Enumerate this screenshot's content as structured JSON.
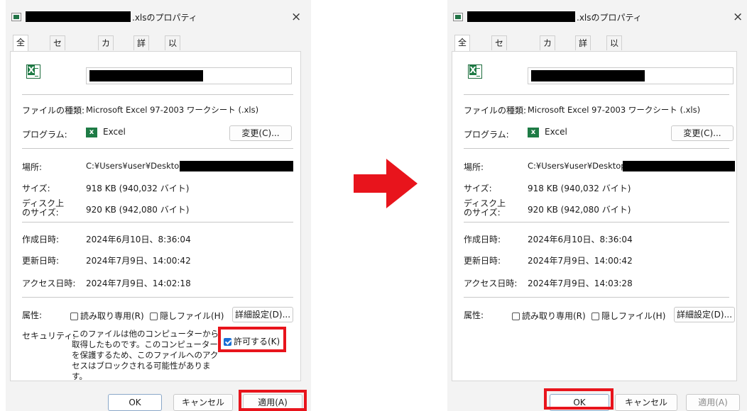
{
  "left": {
    "title_suffix": ".xlsのプロパティ",
    "close": "×",
    "tabs": [
      "全般",
      "セキュリティ",
      "カスタム",
      "詳細",
      "以前のバージョン"
    ],
    "file_type_label": "ファイルの種類:",
    "file_type_value": "Microsoft Excel 97-2003 ワークシート (.xls)",
    "program_label": "プログラム:",
    "program_value": "Excel",
    "change_button": "変更(C)...",
    "location_label": "場所:",
    "location_value": "C:¥Users¥user¥Desktop¥",
    "size_label": "サイズ:",
    "size_value": "918 KB (940,032 バイト)",
    "disk_size_label_1": "ディスク上",
    "disk_size_label_2": "のサイズ:",
    "disk_size_value": "920 KB (942,080 バイト)",
    "created_label": "作成日時:",
    "created_value": "2024年6月10日、8:36:04",
    "modified_label": "更新日時:",
    "modified_value": "2024年7月9日、14:00:42",
    "accessed_label": "アクセス日時:",
    "accessed_value": "2024年7月9日、14:02:18",
    "attr_label": "属性:",
    "readonly_label": "読み取り専用(R)",
    "hidden_label": "隠しファイル(H)",
    "advanced_button": "詳細設定(D)...",
    "security_label": "セキュリティ:",
    "security_text": "このファイルは他のコンピューターから取得したものです。このコンピューターを保護するため、このファイルへのアクセスはブロックされる可能性があります。",
    "unblock_label": "許可する(K)",
    "ok": "OK",
    "cancel": "キャンセル",
    "apply": "適用(A)"
  },
  "right": {
    "title_suffix": ".xlsのプロパティ",
    "close": "×",
    "tabs": [
      "全般",
      "セキュリティ",
      "カスタム",
      "詳細",
      "以前のバージョン"
    ],
    "file_type_label": "ファイルの種類:",
    "file_type_value": "Microsoft Excel 97-2003 ワークシート (.xls)",
    "program_label": "プログラム:",
    "program_value": "Excel",
    "change_button": "変更(C)...",
    "location_label": "場所:",
    "location_value": "C:¥Users¥user¥Desktop¥",
    "size_label": "サイズ:",
    "size_value": "918 KB (940,032 バイト)",
    "disk_size_label_1": "ディスク上",
    "disk_size_label_2": "のサイズ:",
    "disk_size_value": "920 KB (942,080 バイト)",
    "created_label": "作成日時:",
    "created_value": "2024年6月10日、8:36:04",
    "modified_label": "更新日時:",
    "modified_value": "2024年7月9日、14:00:42",
    "accessed_label": "アクセス日時:",
    "accessed_value": "2024年7月9日、14:03:28",
    "attr_label": "属性:",
    "readonly_label": "読み取り専用(R)",
    "hidden_label": "隠しファイル(H)",
    "advanced_button": "詳細設定(D)...",
    "ok": "OK",
    "cancel": "キャンセル",
    "apply": "適用(A)"
  },
  "colors": {
    "highlight": "#e8141c",
    "arrow": "#e8141c",
    "checkbox_checked": "#1a6fd6"
  },
  "unblock_checked": true
}
